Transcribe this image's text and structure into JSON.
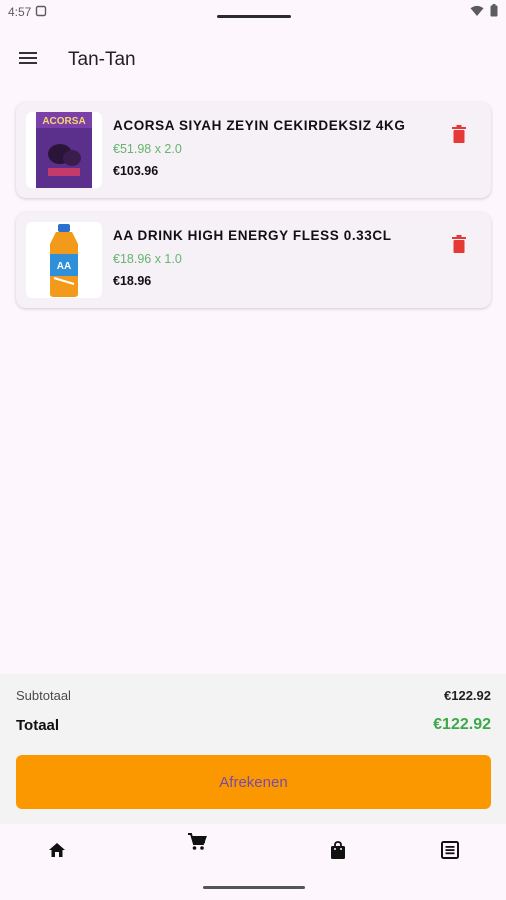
{
  "status": {
    "time": "4:57"
  },
  "app": {
    "title": "Tan-Tan"
  },
  "cart": {
    "items": [
      {
        "name": "ACORSA SIYAH ZEYIN CEKIRDEKSIZ 4KG",
        "unit_line": "€51.98 x 2.0",
        "total": "€103.96",
        "thumb_label": "ACORSA"
      },
      {
        "name": "AA DRINK HIGH ENERGY FLESS 0.33CL",
        "unit_line": "€18.96 x 1.0",
        "total": "€18.96",
        "thumb_label": "AA"
      }
    ]
  },
  "summary": {
    "subtotal_label": "Subtotaal",
    "subtotal_value": "€122.92",
    "total_label": "Totaal",
    "total_value": "€122.92",
    "checkout_label": "Afrekenen"
  },
  "nav": {
    "items": [
      {
        "icon": "home-icon"
      },
      {
        "icon": "cart-icon"
      },
      {
        "icon": "shopping-bag-icon"
      },
      {
        "icon": "receipt-icon"
      }
    ]
  },
  "colors": {
    "accent": "#fb9800",
    "price_green": "#3ba94a",
    "delete_red": "#e53935"
  }
}
